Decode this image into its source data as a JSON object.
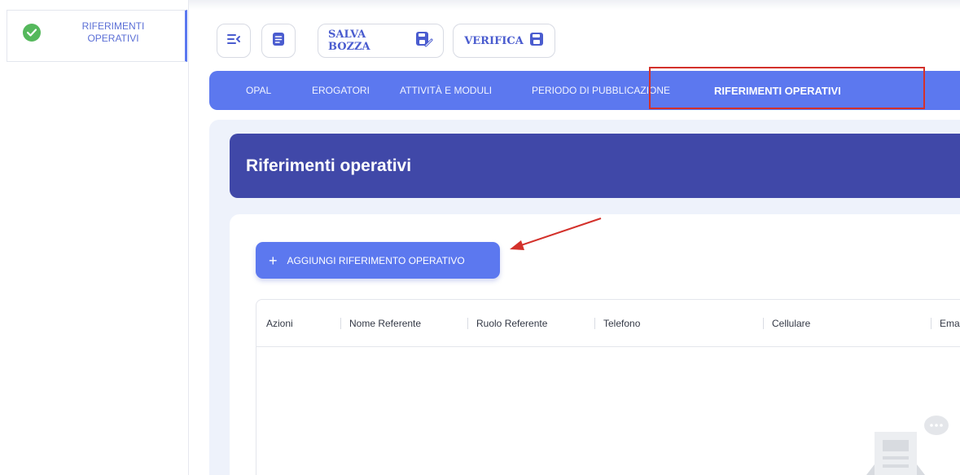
{
  "sidebar": {
    "item_label": "RIFERIMENTI OPERATIVI",
    "item_status": "check-icon",
    "status_color": "#55b85c"
  },
  "toolbar": {
    "collapse_icon": "collapse-menu-icon",
    "document_icon": "document-icon",
    "save_draft_label": "SALVA BOZZA",
    "save_draft_icon": "edit-save-icon",
    "verify_label": "VERIFICA",
    "verify_icon": "floppy-disk-icon"
  },
  "tabs": [
    {
      "label": "OPAL",
      "active": false
    },
    {
      "label": "EROGATORI",
      "active": false
    },
    {
      "label": "ATTIVITÀ E MODULI",
      "active": false
    },
    {
      "label": "PERIODO DI PUBBLICAZIONE",
      "active": false
    },
    {
      "label": "RIFERIMENTI OPERATIVI",
      "active": true
    }
  ],
  "main": {
    "title": "Riferimenti operativi",
    "add_button_label": "AGGIUNGI RIFERIMENTO OPERATIVO",
    "table": {
      "columns": [
        "Azioni",
        "Nome Referente",
        "Ruolo Referente",
        "Telefono",
        "Cellulare",
        "Ema"
      ],
      "rows": []
    }
  },
  "colors": {
    "accent": "#5c78ef",
    "header": "#4048a8",
    "annotation": "#d3312b"
  }
}
